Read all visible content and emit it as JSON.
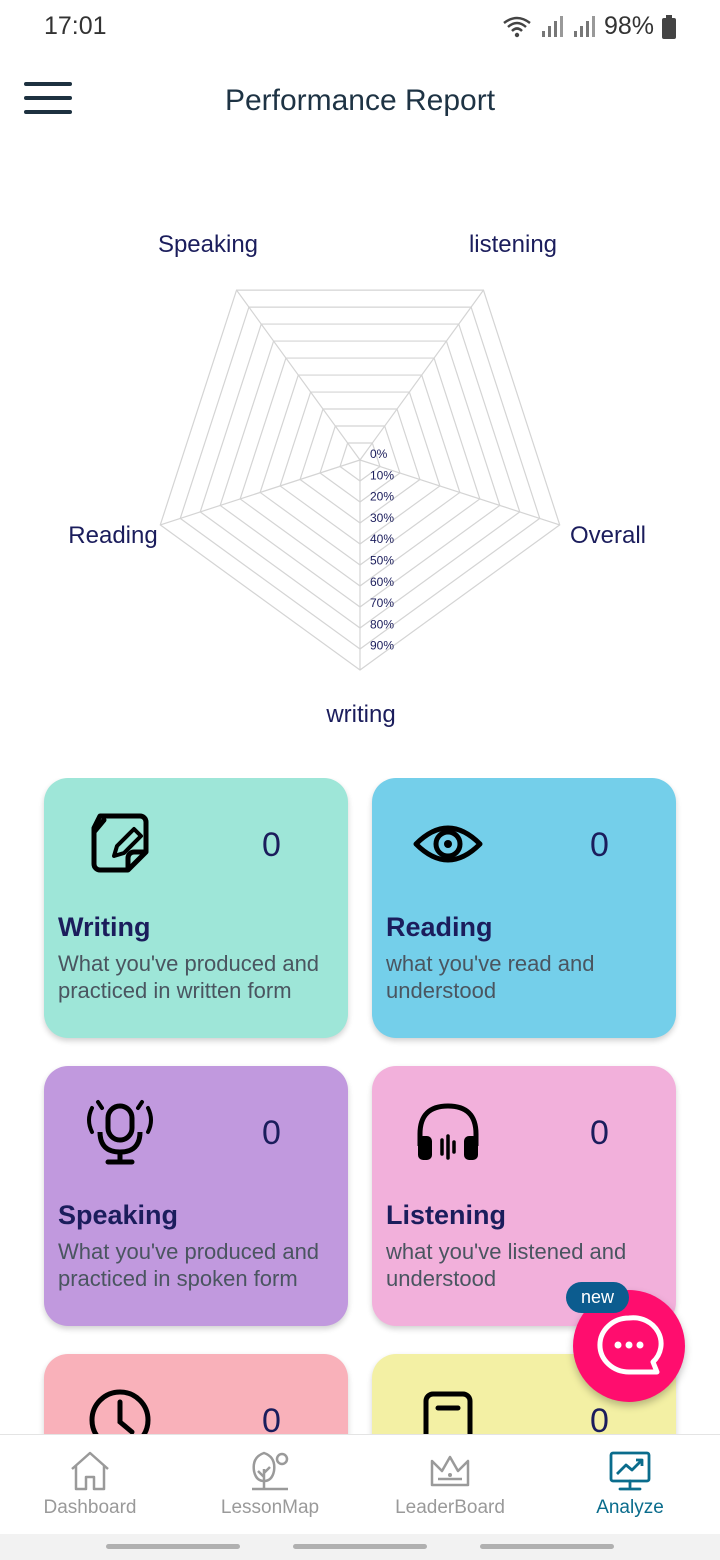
{
  "status_bar": {
    "time": "17:01",
    "battery": "98%"
  },
  "header": {
    "title": "Performance Report"
  },
  "chart_data": {
    "type": "radar",
    "axes": [
      "listening",
      "Overall",
      "writing",
      "Reading",
      "Speaking"
    ],
    "tick_labels": [
      "0%",
      "10%",
      "20%",
      "30%",
      "40%",
      "50%",
      "60%",
      "70%",
      "80%",
      "90%"
    ],
    "rings": 10,
    "range": [
      0,
      100
    ],
    "values": [
      0,
      0,
      0,
      0,
      0
    ],
    "grid": true,
    "grid_color": "#d4d4d4"
  },
  "cards": [
    {
      "title": "Writing",
      "count": "0",
      "description": "What you've produced and practiced in written form",
      "color": "#9ee6d8",
      "icon": "edit-note-icon"
    },
    {
      "title": "Reading",
      "count": "0",
      "description": "what you've read and understood",
      "color": "#74cfea",
      "icon": "eye-icon"
    },
    {
      "title": "Speaking",
      "count": "0",
      "description": "What you've produced and practiced in spoken form",
      "color": "#c199de",
      "icon": "microphone-icon"
    },
    {
      "title": "Listening",
      "count": "0",
      "description": "what you've listened and understood",
      "color": "#f2b0db",
      "icon": "headphones-icon"
    },
    {
      "title": "",
      "count": "0",
      "description": "",
      "color": "#f9b1ba",
      "icon": "clock-icon"
    },
    {
      "title": "",
      "count": "0",
      "description": "",
      "color": "#f3f0a4",
      "icon": "note-icon"
    }
  ],
  "fab": {
    "badge": "new",
    "icon": "chat-bubble-icon",
    "color": "#ff0d6e"
  },
  "bottom_nav": {
    "items": [
      {
        "label": "Dashboard",
        "icon": "home-icon"
      },
      {
        "label": "LessonMap",
        "icon": "map-tree-icon"
      },
      {
        "label": "LeaderBoard",
        "icon": "crown-icon"
      },
      {
        "label": "Analyze",
        "icon": "analytics-monitor-icon",
        "active": true
      }
    ],
    "active_color": "#0a6c8c"
  }
}
